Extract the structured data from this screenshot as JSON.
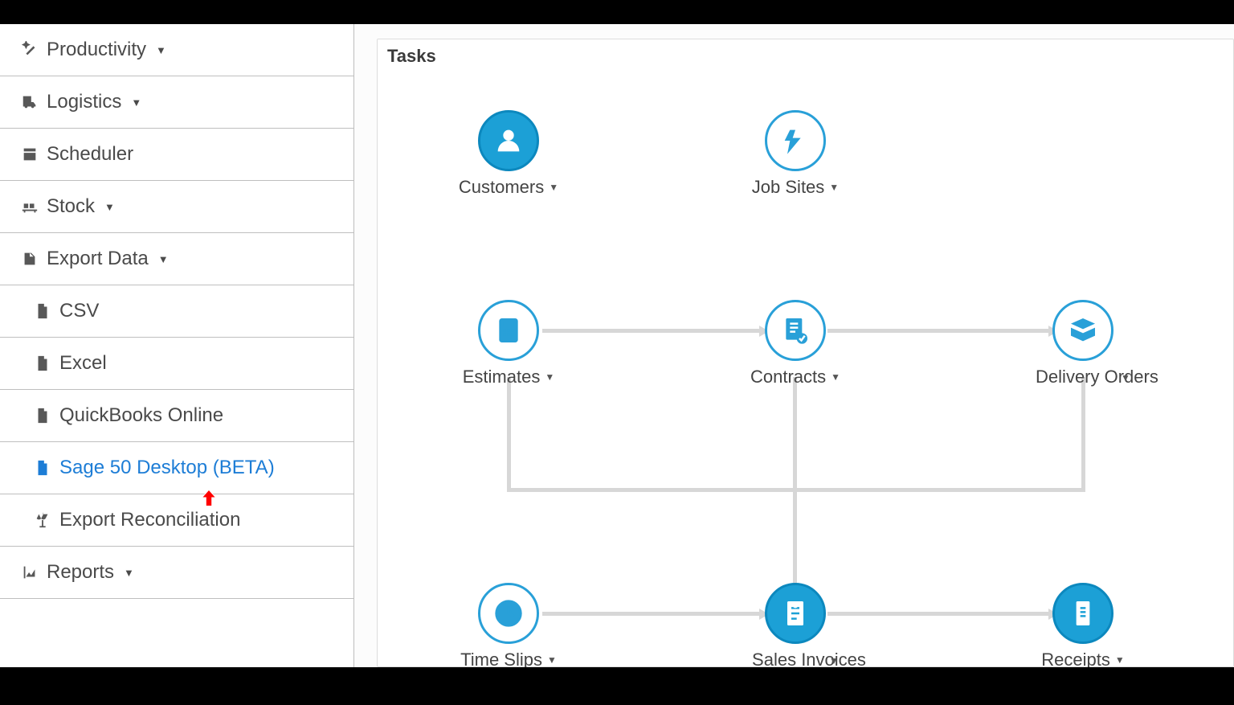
{
  "sidebar": {
    "items": [
      {
        "label": "Productivity",
        "icon": "wand-icon",
        "hasCaret": true,
        "sub": false
      },
      {
        "label": "Logistics",
        "icon": "truck-icon",
        "hasCaret": true,
        "sub": false
      },
      {
        "label": "Scheduler",
        "icon": "calendar-icon",
        "hasCaret": false,
        "sub": false
      },
      {
        "label": "Stock",
        "icon": "pallet-icon",
        "hasCaret": true,
        "sub": false
      },
      {
        "label": "Export Data",
        "icon": "export-icon",
        "hasCaret": true,
        "sub": false
      },
      {
        "label": "CSV",
        "icon": "file-icon",
        "hasCaret": false,
        "sub": true
      },
      {
        "label": "Excel",
        "icon": "file-icon",
        "hasCaret": false,
        "sub": true
      },
      {
        "label": "QuickBooks Online",
        "icon": "file-icon",
        "hasCaret": false,
        "sub": true
      },
      {
        "label": "Sage 50 Desktop (BETA)",
        "icon": "file-icon",
        "hasCaret": false,
        "sub": true,
        "active": true
      },
      {
        "label": "Export Reconciliation",
        "icon": "scale-icon",
        "hasCaret": false,
        "sub": true
      },
      {
        "label": "Reports",
        "icon": "chart-icon",
        "hasCaret": true,
        "sub": false
      }
    ]
  },
  "main": {
    "title": "Tasks",
    "nodes": {
      "customers": "Customers",
      "jobsites": "Job Sites",
      "estimates": "Estimates",
      "contracts": "Contracts",
      "delivery": "Delivery Orders",
      "timeslips": "Time Slips",
      "salesinv": "Sales Invoices",
      "receipts": "Receipts"
    }
  },
  "colors": {
    "accent": "#1ca0d6",
    "link": "#1d7dd6"
  }
}
